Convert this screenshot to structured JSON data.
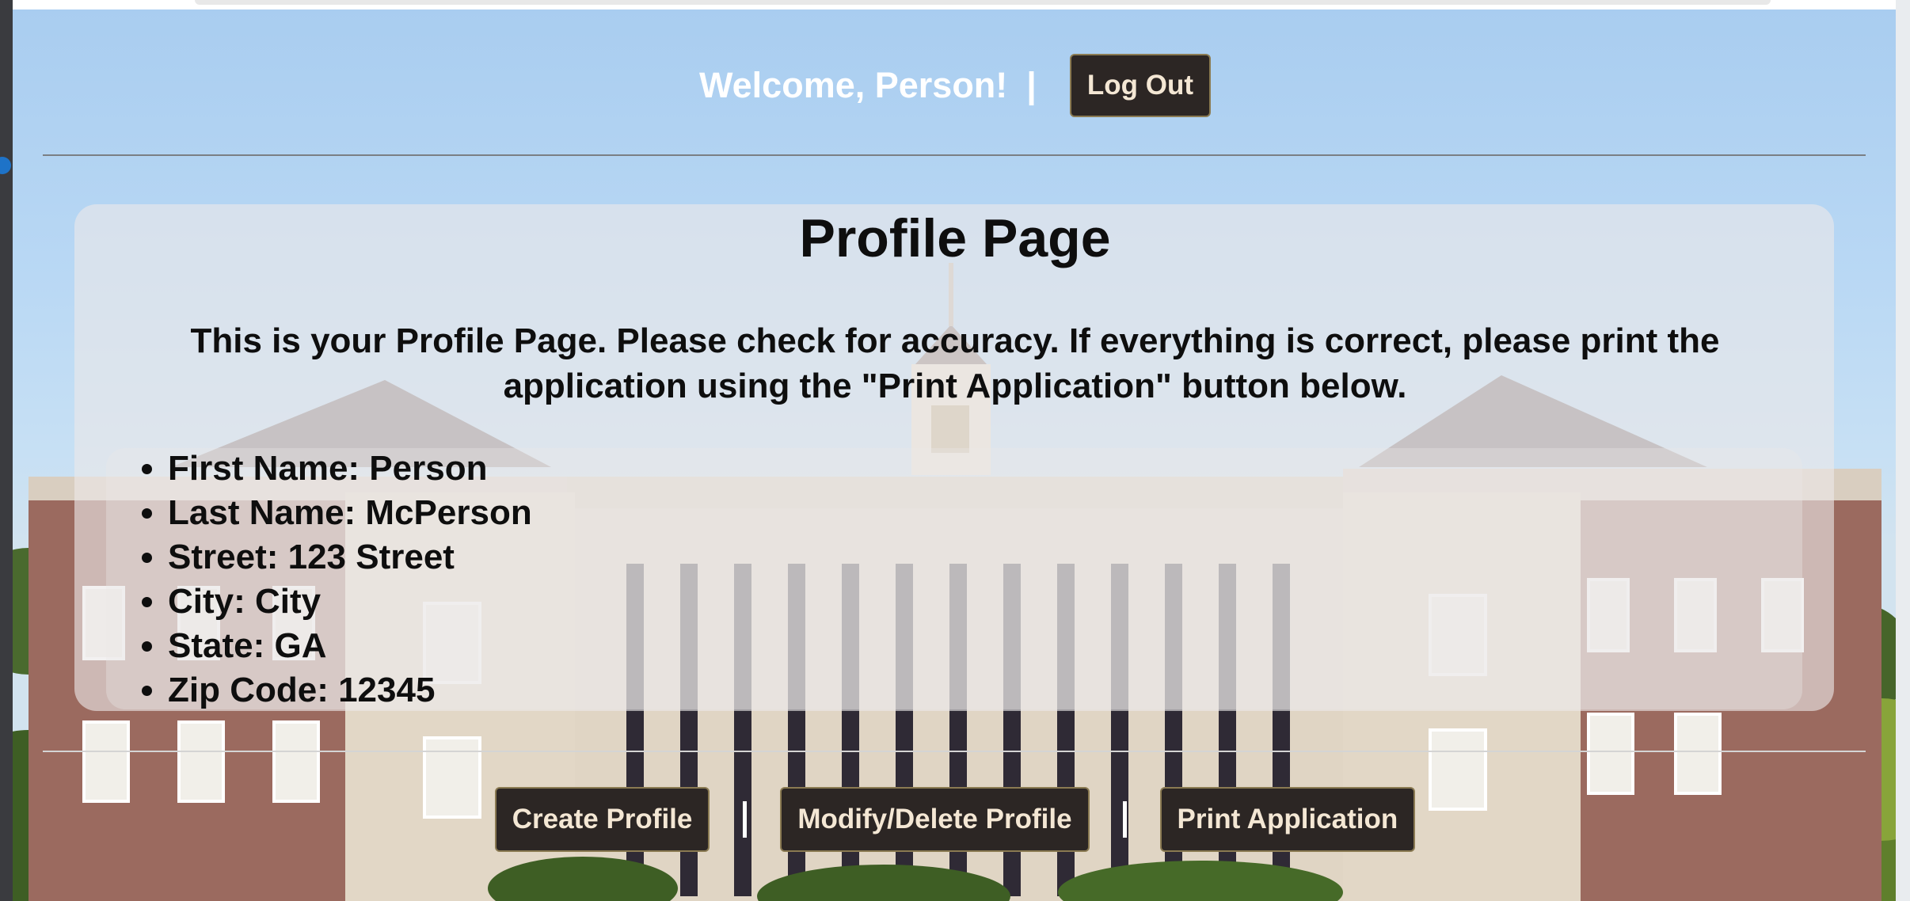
{
  "header": {
    "welcome_text": "Welcome, Person!",
    "separator": "|",
    "logout_label": "Log Out"
  },
  "main": {
    "title": "Profile Page",
    "intro": "This is your Profile Page. Please check for accuracy. If everything is correct, please print the application using the \"Print Application\" button below.",
    "details": [
      "First Name: Person",
      "Last Name: McPerson",
      "Street: 123 Street",
      "City: City",
      "State: GA",
      "Zip Code: 12345"
    ]
  },
  "actions": {
    "create_label": "Create Profile",
    "modify_label": "Modify/Delete Profile",
    "print_label": "Print Application"
  },
  "colors": {
    "button_bg": "#2c2624",
    "button_text": "#f4e7d4",
    "text": "#0e0e0e"
  }
}
